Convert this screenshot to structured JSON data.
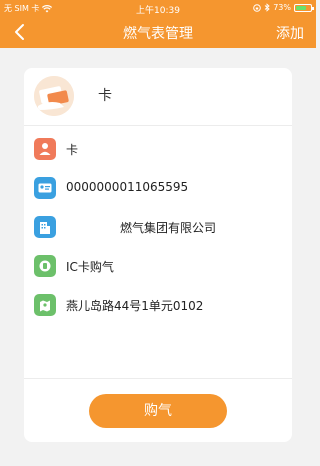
{
  "status_bar": {
    "carrier": "无 SIM 卡",
    "time": "上午10:39",
    "battery": "73%",
    "battery_level": 0.73
  },
  "navbar": {
    "title": "燃气表管理",
    "add_label": "添加"
  },
  "card": {
    "name": "卡",
    "rows": [
      {
        "icon": "user-icon",
        "text": "卡"
      },
      {
        "icon": "id-card-icon",
        "text": "0000000011065595"
      },
      {
        "icon": "building-icon",
        "text": "燃气集团有限公司"
      },
      {
        "icon": "ic-card-icon",
        "text": "IC卡购气"
      },
      {
        "icon": "location-icon",
        "text": "燕儿岛路44号1单元0102"
      }
    ],
    "buy_label": "购气"
  },
  "colors": {
    "accent": "#f5962f",
    "user_icon": "#f07a5a",
    "id_icon": "#3aa0e0",
    "building_icon": "#3aa0e0",
    "ic_icon": "#6cc06a",
    "location_icon": "#6cc06a"
  }
}
